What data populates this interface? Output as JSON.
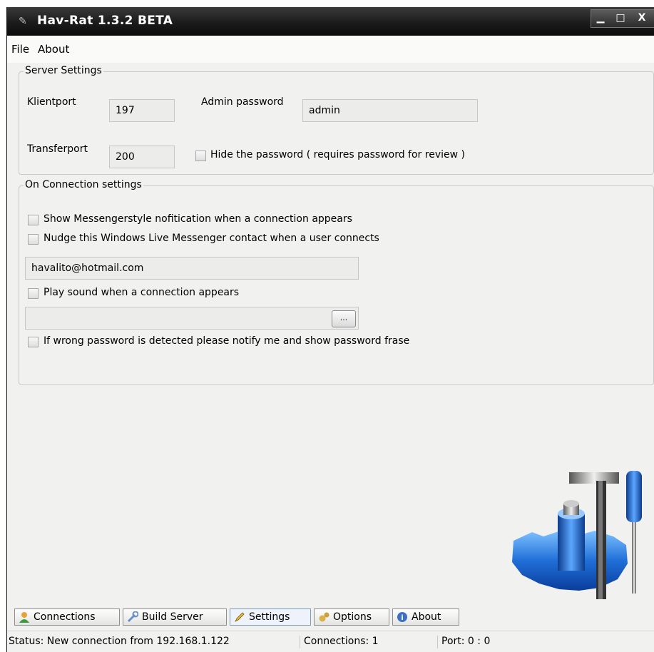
{
  "window": {
    "title": "Hav-Rat 1.3.2 BETA"
  },
  "menu": {
    "file": "File",
    "about": "About"
  },
  "server_settings": {
    "title": "Server Settings",
    "klientport_label": "Klientport",
    "klientport_value": "197",
    "admin_password_label": "Admin password",
    "admin_password_value": "admin",
    "transferport_label": "Transferport",
    "transferport_value": "200",
    "hide_password_label": "Hide the password ( requires password for review )"
  },
  "connection_settings": {
    "title": "On Connection settings",
    "show_notification_label": "Show Messengerstyle nofitication when a connection appears",
    "nudge_label": "Nudge this Windows Live Messenger contact when a user connects",
    "contact_email": "havalito@hotmail.com",
    "play_sound_label": "Play sound when a connection appears",
    "sound_file": "",
    "browse_label": "...",
    "wrong_password_label": "If wrong password is detected please notify me and show password frase"
  },
  "tabs": [
    {
      "label": "Connections",
      "icon": "users-icon"
    },
    {
      "label": "Build Server",
      "icon": "wrench-icon"
    },
    {
      "label": "Settings",
      "icon": "pencil-icon",
      "active": true
    },
    {
      "label": "Options",
      "icon": "gears-icon"
    },
    {
      "label": "About",
      "icon": "info-icon"
    }
  ],
  "status": {
    "message": "Status: New connection from 192.168.1.122",
    "connections": "Connections: 1",
    "port": "Port: 0 : 0"
  },
  "colors": {
    "titlebar": "#1b1b1b",
    "accent": "#1f6fd8",
    "background": "#f1f1ef"
  }
}
